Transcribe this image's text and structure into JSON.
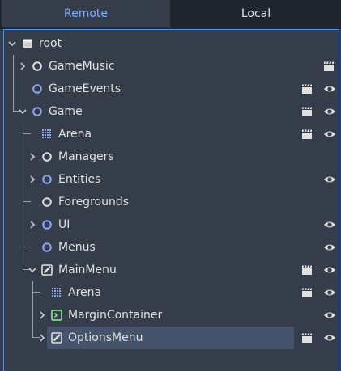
{
  "tabs": [
    {
      "label": "Remote",
      "active": true
    },
    {
      "label": "Local",
      "active": false
    }
  ],
  "tree": {
    "rows": [
      {
        "label": "root",
        "icon": "window-icon",
        "arrow": "expanded",
        "script": false,
        "visibility": false
      },
      {
        "label": "GameMusic",
        "icon": "node-icon",
        "arrow": "collapsed",
        "script": true,
        "visibility": false
      },
      {
        "label": "GameEvents",
        "icon": "node-icon",
        "arrow": "none",
        "script": true,
        "visibility": true
      },
      {
        "label": "Game",
        "icon": "node-icon",
        "arrow": "expanded",
        "script": true,
        "visibility": true
      },
      {
        "label": "Arena",
        "icon": "grid-icon",
        "arrow": "none",
        "script": true,
        "visibility": true
      },
      {
        "label": "Managers",
        "icon": "node-icon",
        "arrow": "collapsed",
        "script": false,
        "visibility": false
      },
      {
        "label": "Entities",
        "icon": "node-icon",
        "arrow": "collapsed",
        "script": false,
        "visibility": true
      },
      {
        "label": "Foregrounds",
        "icon": "node-icon",
        "arrow": "none",
        "script": false,
        "visibility": false
      },
      {
        "label": "UI",
        "icon": "node-icon",
        "arrow": "collapsed",
        "script": false,
        "visibility": true
      },
      {
        "label": "Menus",
        "icon": "node-icon",
        "arrow": "none",
        "script": false,
        "visibility": true
      },
      {
        "label": "MainMenu",
        "icon": "control-icon",
        "arrow": "expanded",
        "script": true,
        "visibility": true
      },
      {
        "label": "Arena",
        "icon": "grid-icon",
        "arrow": "none",
        "script": true,
        "visibility": true
      },
      {
        "label": "MarginContainer",
        "icon": "container-icon",
        "arrow": "collapsed",
        "script": false,
        "visibility": true
      },
      {
        "label": "OptionsMenu",
        "icon": "control-icon",
        "arrow": "collapsed",
        "script": true,
        "visibility": true,
        "selected": true
      }
    ]
  },
  "colors": {
    "background": "#363d4a",
    "tab_bar": "#21262e",
    "accent": "#7eb0ff",
    "node_circle_white": "#e0e0e0",
    "node_circle_blue": "#8da5f3",
    "container_icon": "#8eef97",
    "selection": "#45536c"
  }
}
